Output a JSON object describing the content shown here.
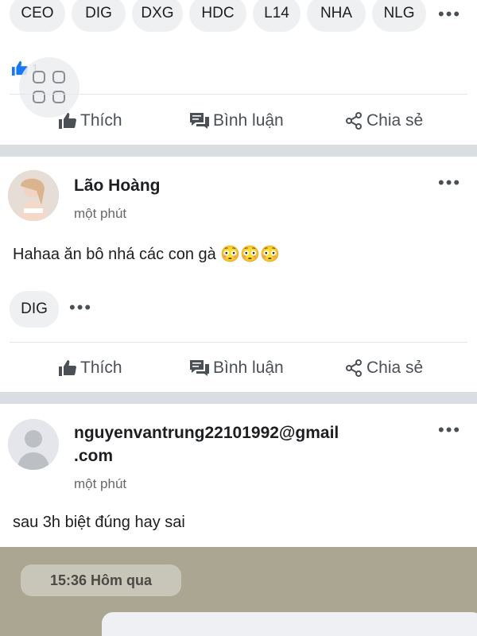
{
  "tags": [
    "CEO",
    "DIG",
    "DXG",
    "HDC",
    "L14",
    "NHA",
    "NLG"
  ],
  "more_glyph": "•••",
  "post1": {
    "like_count": "1"
  },
  "actions": {
    "like": "Thích",
    "comment": "Bình luận",
    "share": "Chia sẻ"
  },
  "post2": {
    "author": "Lão Hoàng",
    "time": "một phút",
    "text": "Hahaa ăn bô nhá các con gà 😳😳😳",
    "tag": "DIG"
  },
  "post3": {
    "author_line1": "nguyenvantrung22101992@gmail",
    "author_line2": ".com",
    "time": "một phút",
    "text": "sau 3h biệt đúng hay sai",
    "image_timestamp": "15:36 Hôm qua"
  },
  "colors": {
    "chip_bg": "#eef0f2",
    "separator": "#dadde1",
    "like_blue": "#1877f2",
    "muted": "#65676b"
  },
  "icons": [
    "thumbs-up-icon",
    "comment-icon",
    "share-icon",
    "more-icon",
    "apps-grid-icon",
    "avatar-placeholder-icon"
  ]
}
